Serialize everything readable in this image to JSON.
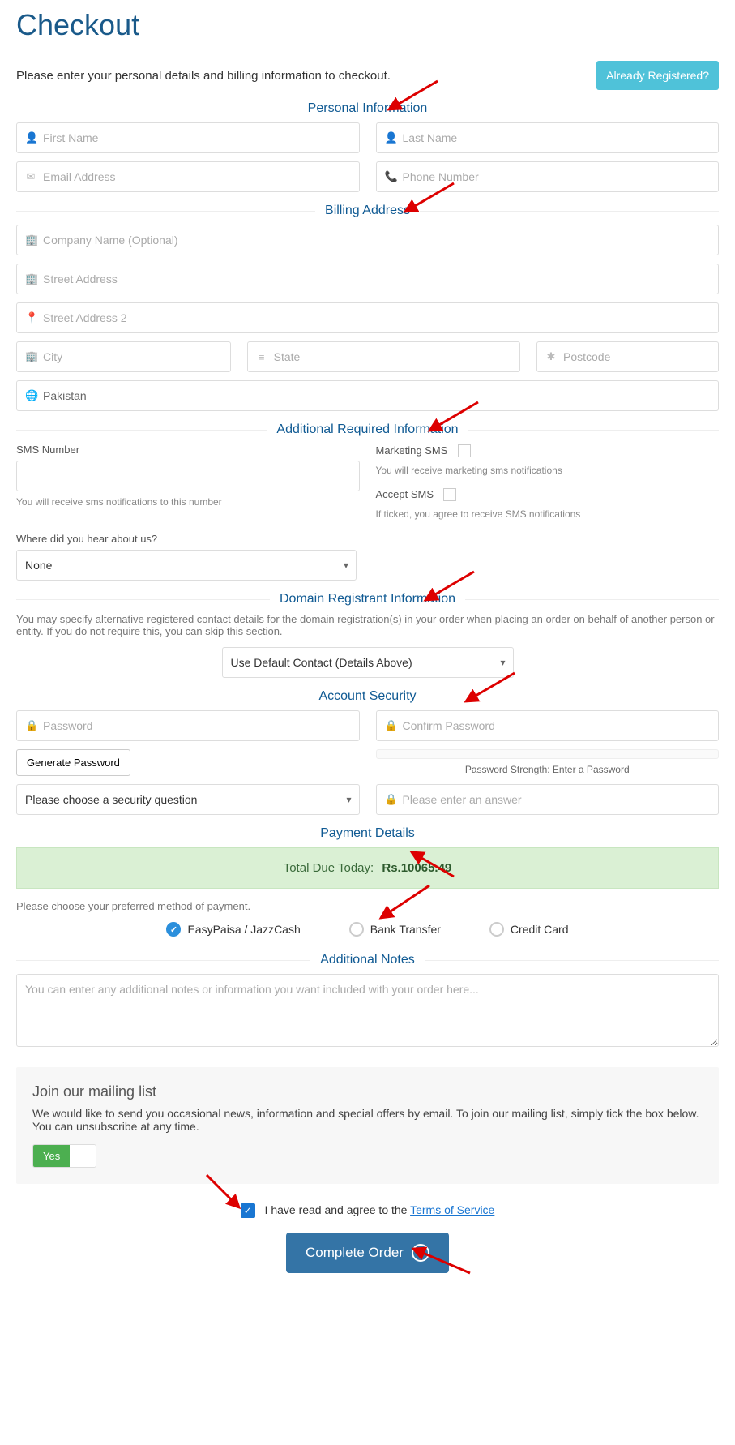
{
  "page_title": "Checkout",
  "intro": "Please enter your personal details and billing information to checkout.",
  "already_registered": "Already Registered?",
  "sections": {
    "personal": "Personal Information",
    "billing": "Billing Address",
    "additional": "Additional Required Information",
    "domain": "Domain Registrant Information",
    "security": "Account Security",
    "payment": "Payment Details",
    "notes": "Additional Notes"
  },
  "placeholders": {
    "first_name": "First Name",
    "last_name": "Last Name",
    "email": "Email Address",
    "phone": "Phone Number",
    "company": "Company Name (Optional)",
    "street": "Street Address",
    "street2": "Street Address 2",
    "city": "City",
    "state": "State",
    "postcode": "Postcode",
    "password": "Password",
    "confirm_password": "Confirm Password",
    "security_answer": "Please enter an answer",
    "notes_ta": "You can enter any additional notes or information you want included with your order here..."
  },
  "country_value": "Pakistan",
  "additional": {
    "sms_number_label": "SMS Number",
    "sms_number_help": "You will receive sms notifications to this number",
    "marketing_sms_label": "Marketing SMS",
    "marketing_sms_help": "You will receive marketing sms notifications",
    "accept_sms_label": "Accept SMS",
    "accept_sms_help": "If ticked, you agree to receive SMS notifications",
    "where_hear_label": "Where did you hear about us?",
    "where_hear_value": "None"
  },
  "domain_help": "You may specify alternative registered contact details for the domain registration(s) in your order when placing an order on behalf of another person or entity. If you do not require this, you can skip this section.",
  "domain_contact_value": "Use Default Contact (Details Above)",
  "security": {
    "generate_password": "Generate Password",
    "strength_label": "Password Strength: Enter a Password",
    "security_question_value": "Please choose a security question"
  },
  "payment": {
    "total_label": "Total Due Today:",
    "total_amount": "Rs.10065.49",
    "choose_method": "Please choose your preferred method of payment.",
    "options": {
      "easypaisa": "EasyPaisa / JazzCash",
      "bank": "Bank Transfer",
      "credit": "Credit Card"
    }
  },
  "mailing": {
    "title": "Join our mailing list",
    "text": "We would like to send you occasional news, information and special offers by email. To join our mailing list, simply tick the box below. You can unsubscribe at any time.",
    "yes": "Yes"
  },
  "tos": {
    "text": "I have read and agree to the ",
    "link": "Terms of Service"
  },
  "complete_order": "Complete Order"
}
